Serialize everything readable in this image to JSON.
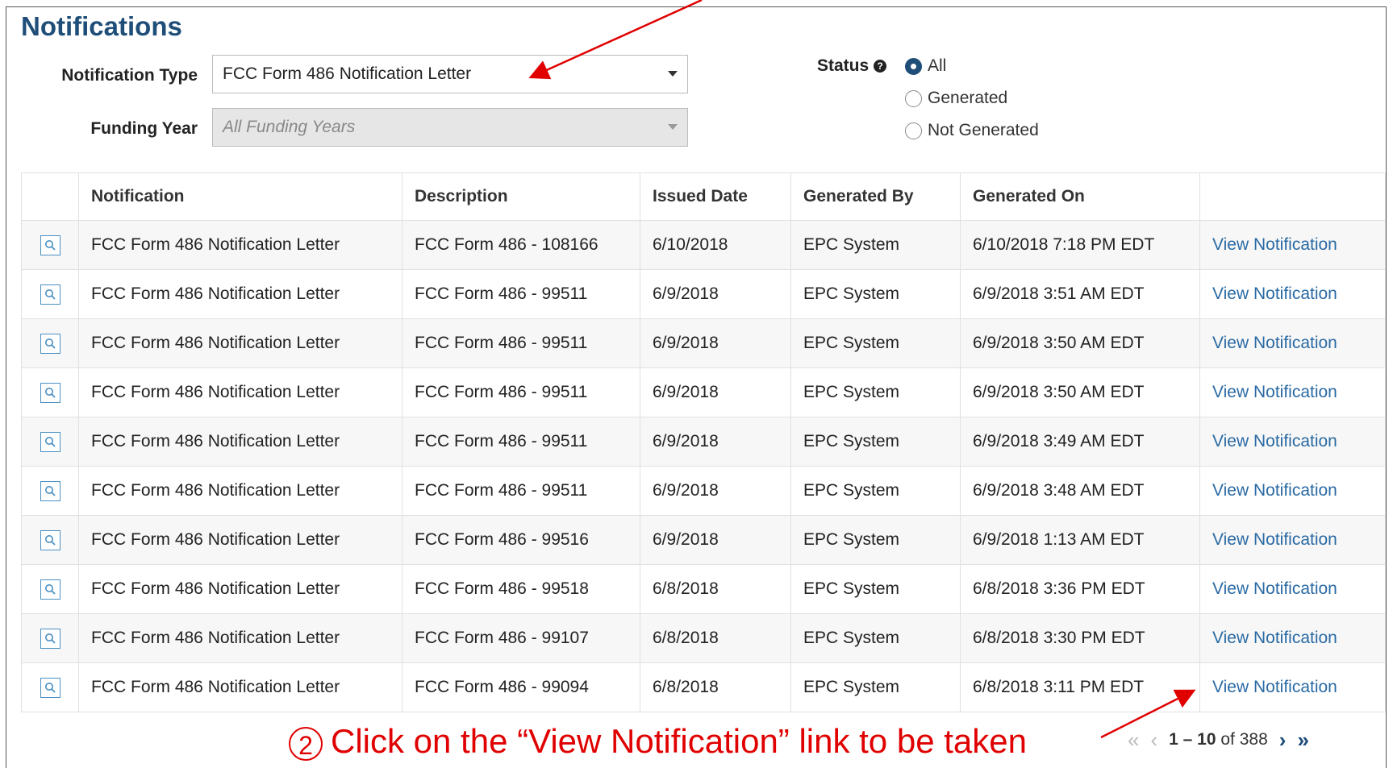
{
  "page": {
    "title": "Notifications"
  },
  "filters": {
    "notification_type_label": "Notification Type",
    "notification_type_value": "FCC Form 486 Notification Letter",
    "funding_year_label": "Funding Year",
    "funding_year_placeholder": "All Funding Years",
    "status_label": "Status",
    "status_options": [
      "All",
      "Generated",
      "Not Generated"
    ],
    "status_selected": "All"
  },
  "table": {
    "columns": [
      "",
      "Notification",
      "Description",
      "Issued Date",
      "Generated By",
      "Generated On",
      ""
    ],
    "rows": [
      {
        "notification": "FCC Form 486 Notification Letter",
        "description": "FCC Form 486 - 108166",
        "issued": "6/10/2018",
        "by": "EPC System",
        "on": "6/10/2018 7:18 PM EDT",
        "action": "View Notification"
      },
      {
        "notification": "FCC Form 486 Notification Letter",
        "description": "FCC Form 486 - 99511",
        "issued": "6/9/2018",
        "by": "EPC System",
        "on": "6/9/2018 3:51 AM EDT",
        "action": "View Notification"
      },
      {
        "notification": "FCC Form 486 Notification Letter",
        "description": "FCC Form 486 - 99511",
        "issued": "6/9/2018",
        "by": "EPC System",
        "on": "6/9/2018 3:50 AM EDT",
        "action": "View Notification"
      },
      {
        "notification": "FCC Form 486 Notification Letter",
        "description": "FCC Form 486 - 99511",
        "issued": "6/9/2018",
        "by": "EPC System",
        "on": "6/9/2018 3:50 AM EDT",
        "action": "View Notification"
      },
      {
        "notification": "FCC Form 486 Notification Letter",
        "description": "FCC Form 486 - 99511",
        "issued": "6/9/2018",
        "by": "EPC System",
        "on": "6/9/2018 3:49 AM EDT",
        "action": "View Notification"
      },
      {
        "notification": "FCC Form 486 Notification Letter",
        "description": "FCC Form 486 - 99511",
        "issued": "6/9/2018",
        "by": "EPC System",
        "on": "6/9/2018 3:48 AM EDT",
        "action": "View Notification"
      },
      {
        "notification": "FCC Form 486 Notification Letter",
        "description": "FCC Form 486 - 99516",
        "issued": "6/9/2018",
        "by": "EPC System",
        "on": "6/9/2018 1:13 AM EDT",
        "action": "View Notification"
      },
      {
        "notification": "FCC Form 486 Notification Letter",
        "description": "FCC Form 486 - 99518",
        "issued": "6/8/2018",
        "by": "EPC System",
        "on": "6/8/2018 3:36 PM EDT",
        "action": "View Notification"
      },
      {
        "notification": "FCC Form 486 Notification Letter",
        "description": "FCC Form 486 - 99107",
        "issued": "6/8/2018",
        "by": "EPC System",
        "on": "6/8/2018 3:30 PM EDT",
        "action": "View Notification"
      },
      {
        "notification": "FCC Form 486 Notification Letter",
        "description": "FCC Form 486 - 99094",
        "issued": "6/8/2018",
        "by": "EPC System",
        "on": "6/8/2018 3:11 PM EDT",
        "action": "View Notification"
      }
    ]
  },
  "pager": {
    "range": "1 – 10",
    "of_label": "of",
    "total": "388",
    "first_icon": "double-chevron-left-icon",
    "prev_icon": "chevron-left-icon",
    "next_icon": "chevron-right-icon",
    "last_icon": "double-chevron-right-icon"
  },
  "annotation": {
    "number": "2",
    "text": "Click on the “View Notification” link to be taken",
    "color": "#e00000"
  },
  "colors": {
    "title": "#1f4e79",
    "link": "#2a6aa3",
    "row_alt": "#f7f7f7"
  }
}
